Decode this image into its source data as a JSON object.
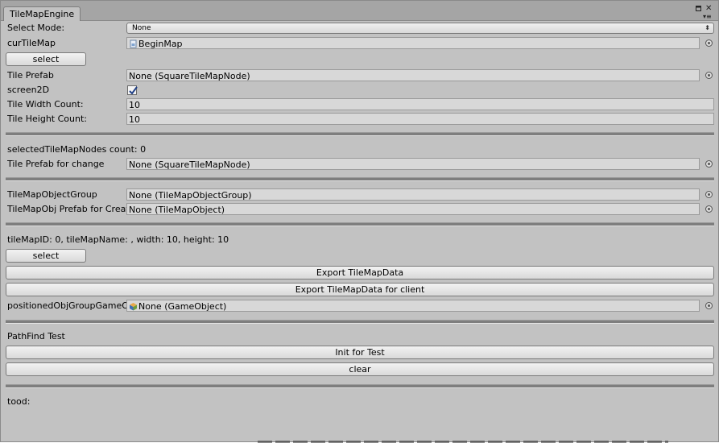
{
  "window": {
    "tab_title": "TileMapEngine",
    "controls": {
      "maximize_icon": "maximize-icon",
      "close_glyph": "✕",
      "menu_glyph": "▾≡"
    }
  },
  "tile_settings": {
    "select_mode": {
      "label": "Select Mode:",
      "value": "None"
    },
    "cur_tilemap": {
      "label": "curTileMap",
      "value": "BeginMap"
    },
    "select_button": "select",
    "tile_prefab": {
      "label": "Tile Prefab",
      "value": "None (SquareTileMapNode)"
    },
    "screen2d": {
      "label": "screen2D",
      "checked": true
    },
    "tile_width_count": {
      "label": "Tile Width Count:",
      "value": "10"
    },
    "tile_height_count": {
      "label": "Tile Height Count:",
      "value": "10"
    }
  },
  "selection": {
    "count_text": "selectedTileMapNodes count: 0",
    "prefab_for_change": {
      "label": "Tile Prefab for change",
      "value": "None (SquareTileMapNode)"
    }
  },
  "objects": {
    "group": {
      "label": "TileMapObjectGroup",
      "value": "None (TileMapObjectGroup)"
    },
    "obj_prefab": {
      "label": "TileMapObj Prefab for Create",
      "value": "None (TileMapObject)"
    }
  },
  "export": {
    "info_text": "tileMapID: 0, tileMapName: , width: 10, height: 10",
    "select_button": "select",
    "export_button": "Export TileMapData",
    "export_client_button": "Export TileMapData for client",
    "positioned_group": {
      "label": "positionedObjGroupGameObject",
      "value": "None (GameObject)"
    }
  },
  "pathfind": {
    "title": "PathFind Test",
    "init_button": "Init for Test",
    "clear_button": "clear"
  },
  "footer": {
    "tood_text": "tood:"
  }
}
